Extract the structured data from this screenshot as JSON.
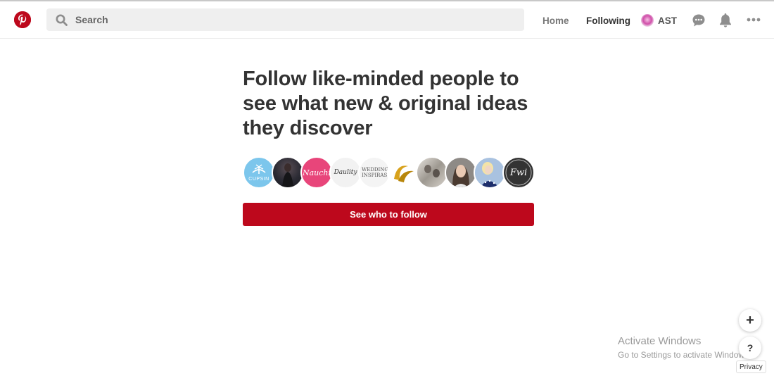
{
  "header": {
    "search_placeholder": "Search",
    "nav": {
      "home": "Home",
      "following": "Following"
    },
    "profile_name": "AST",
    "icons": [
      "pinterest-logo-icon",
      "search-icon",
      "chat-icon",
      "bell-icon",
      "more-icon"
    ]
  },
  "main": {
    "headline": "Follow like-minded people to see what new & original ideas they discover",
    "avatars": [
      {
        "label": "CUPSIN",
        "color": "#7cc6ec"
      },
      {
        "label": "",
        "color": "#2a2a33"
      },
      {
        "label": "Nauchi",
        "color": "#e8457a"
      },
      {
        "label": "Daulity",
        "color": "#f2f2f2"
      },
      {
        "label": "WEDDING INSPIRAS",
        "color": "#f4f4f4"
      },
      {
        "label": "",
        "color": "#d8a21c"
      },
      {
        "label": "",
        "color": "#b9b6b2"
      },
      {
        "label": "",
        "color": "#8e8a86"
      },
      {
        "label": "",
        "color": "#a9c2e0"
      },
      {
        "label": "Fwi",
        "color": "#333333"
      }
    ],
    "cta_label": "See who to follow"
  },
  "overlay": {
    "watermark_title": "Activate Windows",
    "watermark_sub": "Go to Settings to activate Windows.",
    "plus": "+",
    "help": "?",
    "privacy": "Privacy"
  },
  "colors": {
    "brand": "#bd081c",
    "text": "#333333",
    "search_bg": "#efefef"
  }
}
